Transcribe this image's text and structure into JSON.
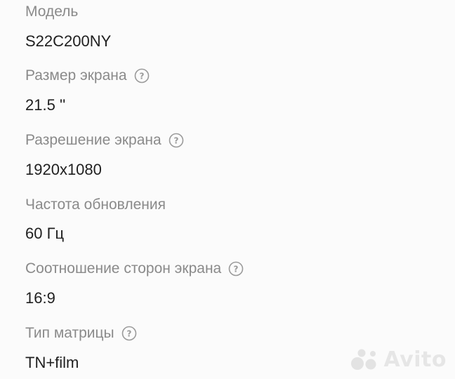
{
  "specs": [
    {
      "label": "Модель",
      "value": "S22C200NY",
      "has_help": false
    },
    {
      "label": "Размер экрана",
      "value": "21.5 ''",
      "has_help": true
    },
    {
      "label": "Разрешение экрана",
      "value": "1920x1080",
      "has_help": true
    },
    {
      "label": "Частота обновления",
      "value": "60 Гц",
      "has_help": false
    },
    {
      "label": "Соотношение сторон экрана",
      "value": "16:9",
      "has_help": true
    },
    {
      "label": "Тип матрицы",
      "value": "TN+film",
      "has_help": true
    }
  ],
  "watermark": {
    "text": "Avito",
    "icon": "avito-logo-dots"
  },
  "colors": {
    "label": "#8a8a8a",
    "value": "#1f1f1f",
    "help_icon": "#9a9a9a"
  }
}
